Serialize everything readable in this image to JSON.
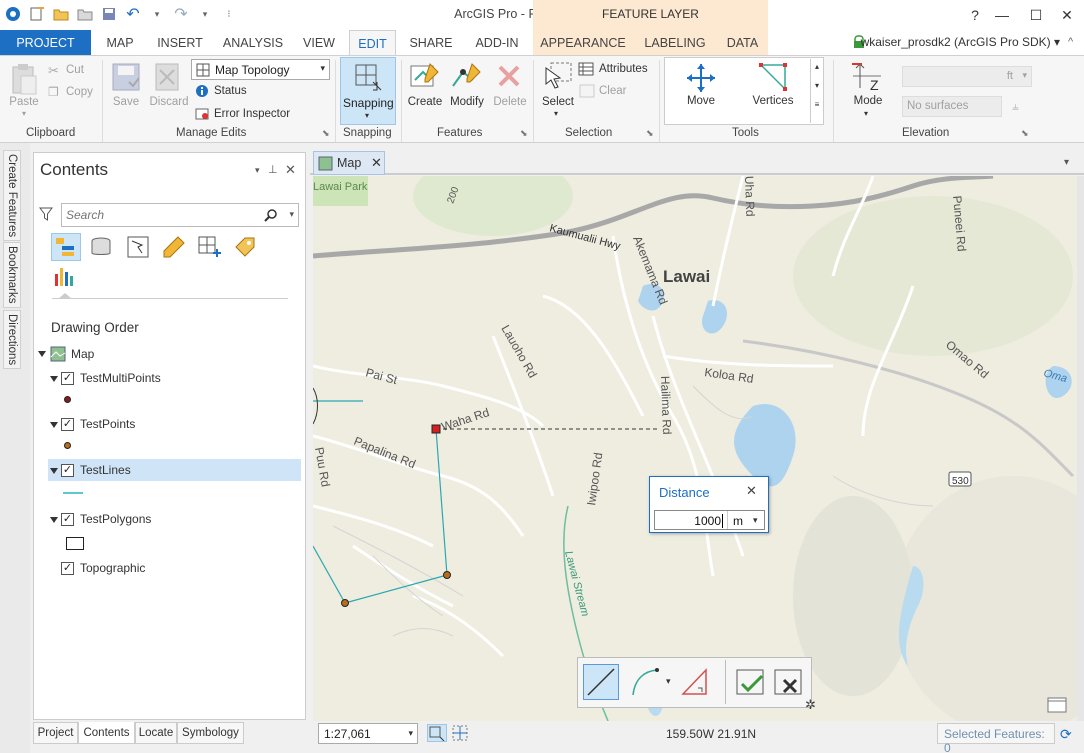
{
  "window": {
    "title": "ArcGIS Pro - FeatureTest - Map",
    "context_header": "FEATURE LAYER",
    "help": "?",
    "minimize": "—",
    "maximize": "☐",
    "close": "✕"
  },
  "tabs": {
    "project": "PROJECT",
    "map": "MAP",
    "insert": "INSERT",
    "analysis": "ANALYSIS",
    "view": "VIEW",
    "edit": "EDIT",
    "share": "SHARE",
    "addin": "ADD-IN",
    "appearance": "APPEARANCE",
    "labeling": "LABELING",
    "data": "DATA"
  },
  "user": "wkaiser_prosdk2 (ArcGIS Pro SDK) ▾",
  "ribbon": {
    "clipboard": {
      "group": "Clipboard",
      "paste": "Paste",
      "cut": "Cut",
      "copy": "Copy"
    },
    "manage_edits": {
      "group": "Manage Edits",
      "save": "Save",
      "discard": "Discard",
      "topology": "Map Topology",
      "status": "Status",
      "error_inspector": "Error Inspector"
    },
    "snapping": {
      "group": "Snapping",
      "label": "Snapping"
    },
    "features": {
      "group": "Features",
      "create": "Create",
      "modify": "Modify",
      "delete": "Delete"
    },
    "selection": {
      "group": "Selection",
      "select": "Select",
      "attributes": "Attributes",
      "clear": "Clear"
    },
    "tools": {
      "group": "Tools",
      "move": "Move",
      "vertices": "Vertices"
    },
    "elevation": {
      "group": "Elevation",
      "mode": "Mode",
      "unit": "ft",
      "surfaces": "No surfaces"
    }
  },
  "side_tabs": {
    "create_features": "Create Features",
    "bookmarks": "Bookmarks",
    "directions": "Directions"
  },
  "contents": {
    "title": "Contents",
    "search_placeholder": "Search",
    "drawing_order": "Drawing Order",
    "map": "Map",
    "layers": [
      {
        "name": "TestMultiPoints"
      },
      {
        "name": "TestPoints"
      },
      {
        "name": "TestLines"
      },
      {
        "name": "TestPolygons"
      },
      {
        "name": "Topographic"
      }
    ]
  },
  "bottom_tabs": {
    "project": "Project",
    "contents": "Contents",
    "locate": "Locate",
    "symbology": "Symbology"
  },
  "map": {
    "tab": "Map",
    "labels": {
      "lawai": "Lawai",
      "kaumualii": "Kaumualii Hwy",
      "akemama": "Akemama Rd",
      "uha": "Uha Rd",
      "laukona": "Lauoho Rd",
      "koloa": "Koloa Rd",
      "omao": "Omao Rd",
      "pai": "Pai St",
      "waha": "Waha Rd",
      "papalina": "Papalina Rd",
      "hailima": "Hailima Rd",
      "iwipoo": "Iwipoo Rd",
      "lawai_stream": "Lawai Stream",
      "puu": "Puu Rd",
      "puneei": "Puneei Rd",
      "lawai_park": "Lawai Park",
      "omao_short": "Oma",
      "route": "530",
      "rd200": "200"
    }
  },
  "distance": {
    "title": "Distance",
    "value": "1000",
    "unit": "m"
  },
  "status": {
    "scale": "1:27,061",
    "coords": "159.50W 21.91N",
    "selected": "Selected Features: 0"
  }
}
